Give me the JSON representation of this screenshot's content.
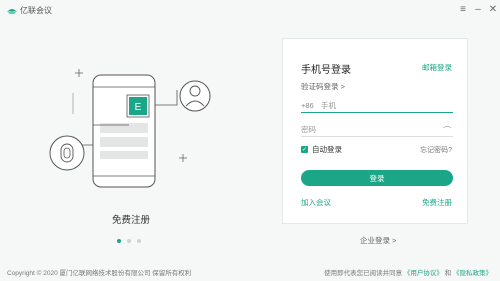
{
  "app": {
    "title": "亿联会议"
  },
  "window": {
    "menu_icon": "≡",
    "min_icon": "–",
    "close_icon": "✕"
  },
  "promo": {
    "caption": "免费注册",
    "dots": 3,
    "active_dot": 0,
    "app_icon_glyph": "E"
  },
  "login": {
    "title": "手机号登录",
    "email_login": "邮箱登录",
    "sms_login": "验证码登录 >",
    "country_code": "+86",
    "phone_placeholder": "手机",
    "password_placeholder": "密码",
    "remember_label": "自动登录",
    "remember_checked": true,
    "forgot": "忘记密码?",
    "login_button": "登录",
    "join_meeting": "加入会议",
    "free_signup": "免费注册"
  },
  "enterprise_login": "企业登录 >",
  "footer": {
    "copyright": "Copyright © 2020 厦门亿联网络技术股份有限公司 保留所有权利",
    "agree_prefix": "使用即代表您已阅读并同意",
    "user_agreement": "《用户协议》",
    "and": "和",
    "privacy_policy": "《隐私政策》"
  },
  "colors": {
    "accent": "#1ba787",
    "background": "#f6f7f7"
  }
}
